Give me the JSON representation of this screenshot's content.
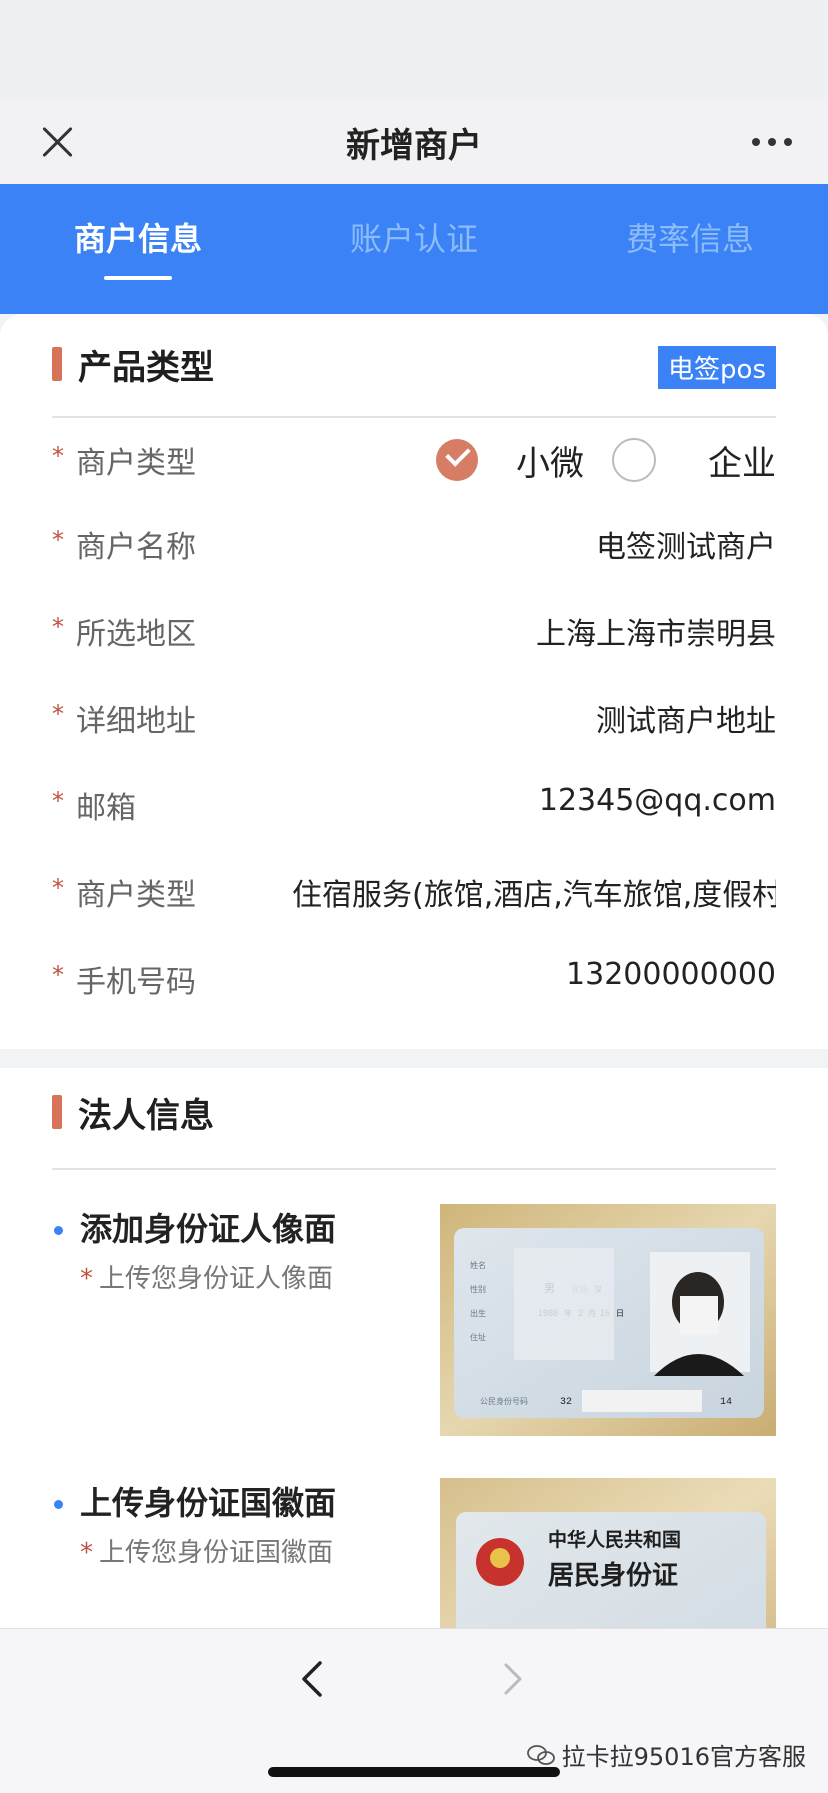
{
  "nav": {
    "title": "新增商户"
  },
  "tabs": [
    {
      "label": "商户信息",
      "active": true
    },
    {
      "label": "账户认证",
      "active": false
    },
    {
      "label": "费率信息",
      "active": false
    }
  ],
  "product_section": {
    "title": "产品类型",
    "badge": "电签pos",
    "rows": [
      {
        "label": "商户类型",
        "type": "radio",
        "options": [
          "小微",
          "企业"
        ],
        "selected": "小微"
      },
      {
        "label": "商户名称",
        "value": "电签测试商户"
      },
      {
        "label": "所选地区",
        "value": "上海上海市崇明县"
      },
      {
        "label": "详细地址",
        "value": "测试商户地址"
      },
      {
        "label": "邮箱",
        "value": "12345@qq.com"
      },
      {
        "label": "商户类型",
        "value": "住宿服务(旅馆,酒店,汽车旅馆,度假村"
      },
      {
        "label": "手机号码",
        "value": "13200000000"
      }
    ],
    "required_mark": "*"
  },
  "legal_section": {
    "title": "法人信息",
    "items": [
      {
        "title": "添加身份证人像面",
        "hint": "上传您身份证人像面"
      },
      {
        "title": "上传身份证国徽面",
        "hint": "上传您身份证国徽面"
      }
    ],
    "id_front": {
      "fields": [
        "姓名",
        "性别",
        "男",
        "民族",
        "汉",
        "出生",
        "1988",
        "年",
        "2",
        "月",
        "15",
        "日",
        "住址",
        "公民身份号码",
        "32",
        "14"
      ]
    },
    "id_back": {
      "line1": "中华人民共和国",
      "line2": "居民身份证"
    }
  },
  "watermark": "拉卡拉95016官方客服",
  "colors": {
    "primary": "#3a82f6",
    "accent": "#d8735a",
    "required": "#c0533f"
  }
}
